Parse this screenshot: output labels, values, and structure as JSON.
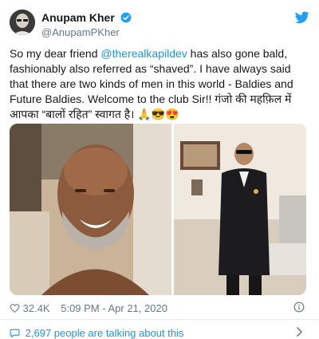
{
  "author": {
    "display_name": "Anupam Kher",
    "handle": "@AnupamPKher"
  },
  "tweet": {
    "text_before_mention": "So my dear friend ",
    "mention": "@therealkapildev",
    "text_after_mention": " has also gone bald, fashionably also referred as “shaved”. I have always said that there are two kinds of men in this world - Baldies and Future Baldies. Welcome to the club Sir!! गंजो की महफ़िल में आपका “बालों रहित” स्वागत है। 🙏😎😍"
  },
  "stats": {
    "likes": "32.4K",
    "timestamp": "5:09 PM - Apr 21, 2020"
  },
  "conversation": {
    "label": "2,697 people are talking about this"
  },
  "icons": {
    "verified": "verified-badge-icon",
    "brand": "twitter-bird-icon",
    "like": "heart-icon",
    "info": "info-icon",
    "talk": "speech-bubble-icon",
    "chevron": "chevron-right-icon"
  },
  "colors": {
    "accent": "#1da1f2",
    "link": "#1b95e0",
    "muted": "#657786"
  }
}
